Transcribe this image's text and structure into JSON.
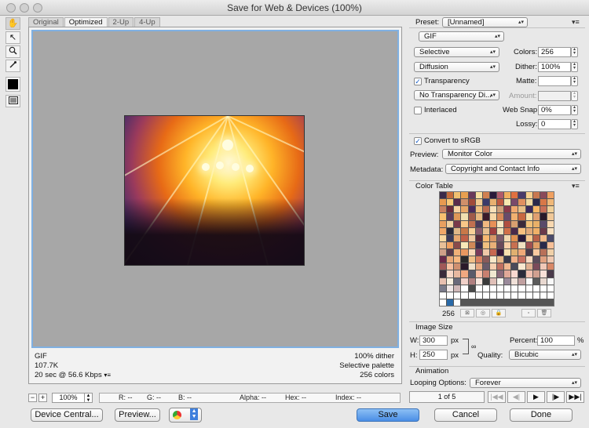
{
  "window": {
    "title": "Save for Web & Devices (100%)"
  },
  "tools": [
    {
      "icon": "hand-icon",
      "glyph": "✋"
    },
    {
      "icon": "slice-select-icon",
      "glyph": "↖"
    },
    {
      "icon": "zoom-icon",
      "glyph": "🔍"
    },
    {
      "icon": "eyedropper-icon",
      "glyph": "✎"
    },
    {
      "icon": "eyedropper-color-icon",
      "glyph": ""
    },
    {
      "icon": "toggle-slices-icon",
      "glyph": "▭"
    }
  ],
  "tabs": [
    {
      "label": "Original",
      "active": false
    },
    {
      "label": "Optimized",
      "active": true
    },
    {
      "label": "2-Up",
      "active": false
    },
    {
      "label": "4-Up",
      "active": false
    }
  ],
  "info": {
    "format": "GIF",
    "size": "107.7K",
    "time": "20 sec @ 56.6 Kbps",
    "dither": "100% dither",
    "palette": "Selective palette",
    "colors": "256 colors"
  },
  "zoom": {
    "value": "100%"
  },
  "pixel_info": {
    "r": "R: --",
    "g": "G: --",
    "b": "B: --",
    "alpha": "Alpha: --",
    "hex": "Hex: --",
    "index": "Index: --"
  },
  "buttons": {
    "device_central": "Device Central...",
    "preview": "Preview...",
    "save": "Save",
    "cancel": "Cancel",
    "done": "Done"
  },
  "settings": {
    "preset_label": "Preset:",
    "preset": "[Unnamed]",
    "format": "GIF",
    "reduction": "Selective",
    "colors_label": "Colors:",
    "colors": "256",
    "dither_algo": "Diffusion",
    "dither_label": "Dither:",
    "dither": "100%",
    "transparency_label": "Transparency",
    "transparency": true,
    "matte_label": "Matte:",
    "trans_dither": "No Transparency Di...",
    "amount_label": "Amount:",
    "interlaced_label": "Interlaced",
    "interlaced": false,
    "websnap_label": "Web Snap:",
    "websnap": "0%",
    "lossy_label": "Lossy:",
    "lossy": "0",
    "srgb_label": "Convert to sRGB",
    "srgb": true,
    "preview_label": "Preview:",
    "preview": "Monitor Color",
    "metadata_label": "Metadata:",
    "metadata": "Copyright and Contact Info"
  },
  "color_table": {
    "label": "Color Table",
    "count": "256",
    "swatches": [
      "#3a2a4a",
      "#c46a3a",
      "#f0c070",
      "#e8a050",
      "#6a3a5a",
      "#f8e0a0",
      "#d08050",
      "#2a1a3a",
      "#b05a6a",
      "#f0b060",
      "#e07040",
      "#4a3a6a",
      "#f8d090",
      "#c87850",
      "#8a4a5a",
      "#f0a060",
      "#e89a50",
      "#f8c878",
      "#5a2a4a",
      "#d0906a",
      "#a04a3a",
      "#f0c890",
      "#3a3a6a",
      "#e8b070",
      "#c05a40",
      "#f8e8b0",
      "#7a4a6a",
      "#e09060",
      "#f0d8a0",
      "#2a2a4a",
      "#d87848",
      "#f0b878",
      "#c88060",
      "#6a2a3a",
      "#f8d0a0",
      "#e8a868",
      "#4a2a5a",
      "#f0c080",
      "#b86a50",
      "#f8e0b8",
      "#d0a078",
      "#8a3a4a",
      "#f0a870",
      "#e8c088",
      "#3a2a5a",
      "#f8b868",
      "#c87058",
      "#f0d098",
      "#f8c070",
      "#5a3a5a",
      "#e09858",
      "#f0e0b0",
      "#a05a4a",
      "#e8b880",
      "#3a1a2a",
      "#f8d8a8",
      "#d88858",
      "#6a4a6a",
      "#f0b070",
      "#c86840",
      "#f8e0a8",
      "#e0a070",
      "#2a1a2a",
      "#f0c898",
      "#e8a060",
      "#f0d0a0",
      "#7a3a4a",
      "#f8c888",
      "#c07050",
      "#4a3a5a",
      "#f0b880",
      "#e89058",
      "#f8e8c0",
      "#b05040",
      "#d8a070",
      "#3a2a3a",
      "#f0c078",
      "#e8b068",
      "#5a4a6a",
      "#f8d8b0",
      "#f0a868",
      "#2a2a3a",
      "#e0b888",
      "#c87848",
      "#f8d098",
      "#8a5a6a",
      "#e8c090",
      "#a04040",
      "#f0e0b8",
      "#d07048",
      "#4a2a4a",
      "#f8c080",
      "#e0a878",
      "#f0b068",
      "#6a3a4a",
      "#f8e0c0",
      "#f8d8a0",
      "#3a3a5a",
      "#e8a870",
      "#c06048",
      "#f0c8a0",
      "#5a2a3a",
      "#f8b870",
      "#d89868",
      "#7a5a6a",
      "#f0d8b0",
      "#e09050",
      "#2a1a3a",
      "#f8c890",
      "#b86048",
      "#f0b888",
      "#4a4a6a",
      "#e8c098",
      "#f0a060",
      "#8a4a4a",
      "#f8e8b8",
      "#d08858",
      "#3a2a4a",
      "#f0c080",
      "#e8b078",
      "#6a4a5a",
      "#f8d0a8",
      "#c87050",
      "#f0e0c0",
      "#a05050",
      "#e0a068",
      "#2a2a4a",
      "#f8c098",
      "#d0a088",
      "#5a3a4a",
      "#f0b078",
      "#e89860",
      "#f8d8b8",
      "#7a3a5a",
      "#f0c8a8",
      "#c86850",
      "#3a1a3a",
      "#f8e0b0",
      "#e0b070",
      "#f0a878",
      "#4a3a4a",
      "#f8c8a0",
      "#b87058",
      "#f0d0a8",
      "#6a2a4a",
      "#e8a878",
      "#f8b880",
      "#2a2a2a",
      "#f0c088",
      "#d88060",
      "#8a5a5a",
      "#f8e8c8",
      "#e8b888",
      "#3a3a4a",
      "#f0b088",
      "#c87060",
      "#f8d8c0",
      "#5a4a5a",
      "#e0a080",
      "#f0c8b0",
      "#a05858",
      "#f8c0a0",
      "#d09070",
      "#2a1a2a",
      "#f0e0c8",
      "#e8a880",
      "#6a5a6a",
      "#f8d0b0",
      "#c07060",
      "#f0b890",
      "#4a4a5a",
      "#f8e8d0",
      "#e0b090",
      "#7a4a5a",
      "#f0c8b8",
      "#d88868",
      "#3a2a3a",
      "#f8d8c8",
      "#e8b8a0",
      "#f0a880",
      "#5a5a6a",
      "#f8c0a8",
      "#c88070",
      "#f0e8d0",
      "#8a6a7a",
      "#e0a898",
      "#f8d8d0",
      "#2a2a3a",
      "#f0c0b0",
      "#d0a090",
      "#f8e0d8",
      "#4a3a4a",
      "#e8c0b0",
      "#f8f0e0",
      "#6a6a7a",
      "#f0d0c8",
      "#b08080",
      "#f8e8e0",
      "#3a3a3a",
      "#e0c0b8",
      "#f8f8f0",
      "#9a8a9a",
      "#f0e0d8",
      "#c0a0a0",
      "#fafafa",
      "#5a5a5a",
      "#e8d8d0",
      "#f8f8f8",
      "#7a7a8a",
      "#f0e8e8",
      "#d0b8b8",
      "#ffffff",
      "#4a4a4a",
      "#ffffff",
      "#ffffff",
      "#ffffff",
      "#ffffff",
      "#ffffff",
      "#ffffff",
      "#ffffff",
      "#ffffff",
      "#ffffff",
      "#ffffff",
      "#ffffff",
      "#ffffff",
      "#ffffff",
      "#ffffff",
      "#ffffff",
      "#ffffff",
      "#ffffff",
      "#ffffff",
      "#ffffff",
      "#ffffff",
      "#ffffff",
      "#ffffff",
      "#ffffff",
      "#ffffff",
      "#ffffff",
      "#ffffff",
      "#ffffff",
      "#ffffff",
      "#2a6aa8",
      "#ffffff"
    ]
  },
  "image_size": {
    "label": "Image Size",
    "w_label": "W:",
    "w": "300",
    "h_label": "H:",
    "h": "250",
    "unit": "px",
    "percent_label": "Percent:",
    "percent": "100",
    "percent_unit": "%",
    "quality_label": "Quality:",
    "quality": "Bicubic"
  },
  "animation": {
    "label": "Animation",
    "looping_label": "Looping Options:",
    "looping": "Forever",
    "frame": "1 of 5"
  }
}
